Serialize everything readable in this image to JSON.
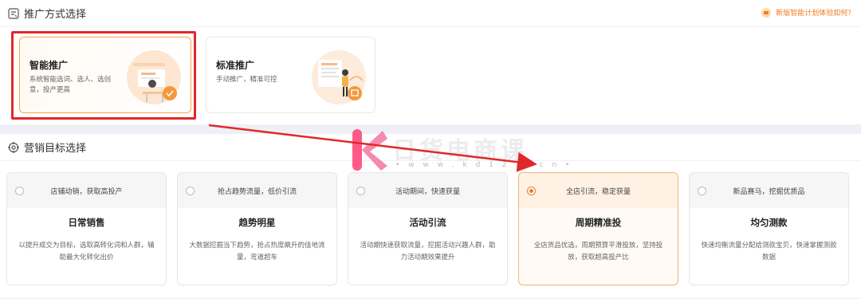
{
  "promo_section": {
    "title": "推广方式选择",
    "feedback_link": "新版智能计划体验如何?",
    "cards": [
      {
        "title": "智能推广",
        "desc_line1": "系统智能选词、选人、选创",
        "desc_line2": "意，投产更高",
        "selected": true
      },
      {
        "title": "标准推广",
        "desc_line1": "手动推广，精准可控",
        "desc_line2": "",
        "selected": false
      }
    ]
  },
  "goal_section": {
    "title": "营销目标选择",
    "cards": [
      {
        "sub": "店铺动销，获取高投产",
        "title": "日常销售",
        "desc": "以提升成交为目标，选取高转化词和人群，辅助最大化转化出价",
        "selected": false
      },
      {
        "sub": "抢占趋势流量，低价引流",
        "title": "趋势明星",
        "desc": "大数据挖掘当下趋势，抢占热度飙升的佳地流量，弯道超车",
        "selected": false
      },
      {
        "sub": "活动期间，快速获量",
        "title": "活动引流",
        "desc": "活动期快速获取流量，挖掘活动兴趣人群，助力活动期效果提升",
        "selected": false
      },
      {
        "sub": "全店引流，稳定获量",
        "title": "周期精准投",
        "desc": "全店货品优选，周期预算平滑投放，坚持投放，获取超高投产比",
        "selected": true
      },
      {
        "sub": "新品赛马，挖掘优质品",
        "title": "均匀测款",
        "desc": "快速均衡流量分配给测款宝贝，快速掌握测款数据",
        "selected": false
      }
    ]
  },
  "watermark": {
    "name": "日货电商课",
    "url": "• w w w . k d 1 2 3 . c n •"
  },
  "colors": {
    "accent": "#f07b22",
    "annotation_red": "#e0282a",
    "selected_border": "#f7a54a"
  },
  "icons": [
    "promo-method-icon",
    "target-icon",
    "feedback-icon",
    "radio-icon",
    "arrow-annotation"
  ]
}
